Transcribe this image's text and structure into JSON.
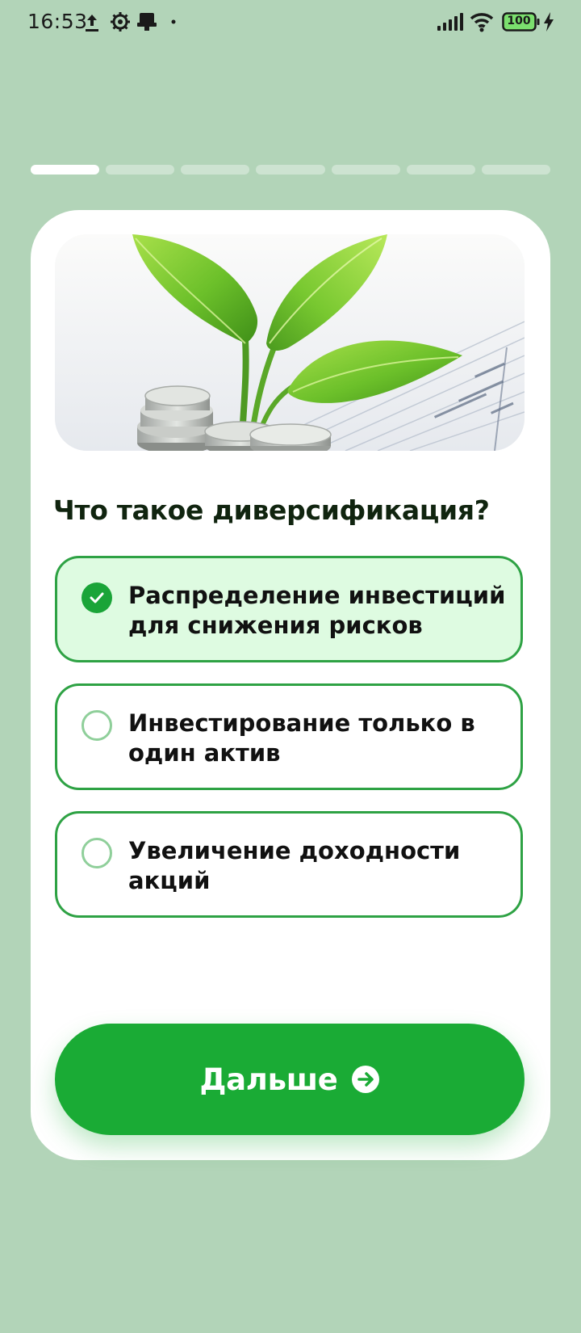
{
  "status_bar": {
    "time": "16:53",
    "battery": "100"
  },
  "progress": {
    "total_steps": 7,
    "current_step": 1
  },
  "question": {
    "text": "Что такое диверсификация?"
  },
  "options": [
    {
      "label": "Распределение инвестиций для снижения рисков",
      "selected": true
    },
    {
      "label": "Инвестирование только в один актив",
      "selected": false
    },
    {
      "label": "Увеличение доходности акций",
      "selected": false
    }
  ],
  "next_button": {
    "label": "Дальше"
  },
  "colors": {
    "background": "#b2d4b8",
    "accent": "#1aab35",
    "option_border": "#2ea244",
    "selected_option_bg": "#defbe1"
  },
  "icons": {
    "selected_radio": "check-icon",
    "next": "arrow-right-circle-icon",
    "hero_image": "plant-sprout-coins-image"
  }
}
